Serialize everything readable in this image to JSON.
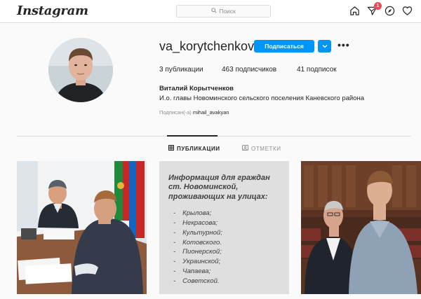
{
  "header": {
    "logo": "Instagram",
    "search_placeholder": "Поиск",
    "notification_count": "1"
  },
  "profile": {
    "username": "va_korytchenkov",
    "follow_label": "Подписаться",
    "stats": {
      "posts_count": "3",
      "posts_label": "публикации",
      "followers_count": "463",
      "followers_label": "подписчиков",
      "following_count": "41",
      "following_label": "подписок"
    },
    "full_name": "Виталий Корытченков",
    "bio": "И.о. главы Новоминского сельского поселения Каневского района",
    "followed_by_prefix": "Подписан(-а)",
    "followed_by_user": "mihail_avakyan"
  },
  "tabs": [
    {
      "label": "ПУБЛИКАЦИИ",
      "icon": "grid-icon"
    },
    {
      "label": "ОТМЕТКИ",
      "icon": "tag-icon"
    }
  ],
  "posts": {
    "post2": {
      "title": "Информация для граждан ст. Новоминской, проживающих на улицах:",
      "streets": [
        "Крылова;",
        "Некрасова;",
        "Культурной;",
        "Котовского.",
        "Пионерской;",
        "Украинской;",
        "Чапаева;",
        "Советской."
      ]
    }
  },
  "colors": {
    "primary_button": "#0095f6",
    "badge": "#ed4956",
    "border": "#dbdbdb",
    "background": "#fafafa"
  }
}
